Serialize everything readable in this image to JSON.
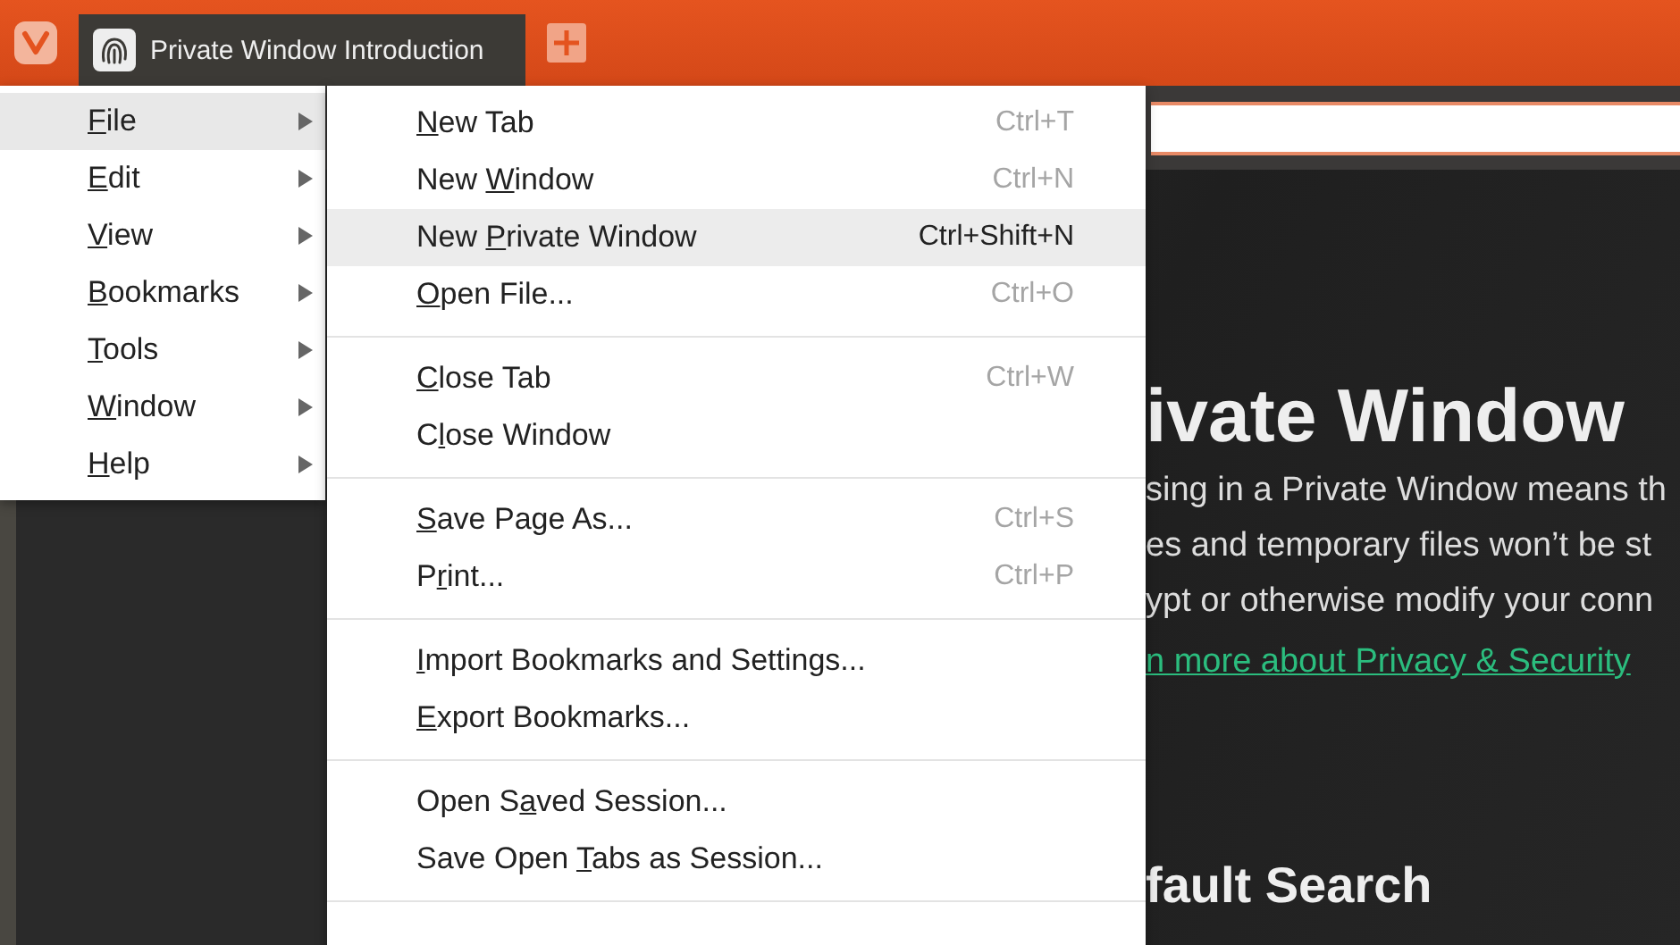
{
  "tab_bar": {
    "tabs": [
      {
        "title": "Private Window Introduction",
        "selected": true
      }
    ]
  },
  "main_menu": {
    "items": [
      {
        "key": "F",
        "post": "ile",
        "has_submenu": true,
        "selected": true
      },
      {
        "key": "E",
        "post": "dit",
        "has_submenu": true,
        "selected": false
      },
      {
        "key": "V",
        "post": "iew",
        "has_submenu": true,
        "selected": false
      },
      {
        "key": "B",
        "post": "ookmarks",
        "has_submenu": true,
        "selected": false
      },
      {
        "key": "T",
        "post": "ools",
        "has_submenu": true,
        "selected": false
      },
      {
        "key": "W",
        "post": "indow",
        "has_submenu": true,
        "selected": false
      },
      {
        "key": "H",
        "post": "elp",
        "has_submenu": true,
        "selected": false
      }
    ]
  },
  "file_menu": {
    "groups": [
      [
        {
          "key": "N",
          "post": "ew Tab",
          "shortcut": "Ctrl+T",
          "selected": false
        },
        {
          "pre": "New ",
          "key": "W",
          "post": "indow",
          "shortcut": "Ctrl+N",
          "selected": false
        },
        {
          "pre": "New ",
          "key": "P",
          "post": "rivate Window",
          "shortcut": "Ctrl+Shift+N",
          "selected": true
        },
        {
          "key": "O",
          "post": "pen File...",
          "shortcut": "Ctrl+O",
          "selected": false
        }
      ],
      [
        {
          "key": "C",
          "post": "lose Tab",
          "shortcut": "Ctrl+W",
          "selected": false
        },
        {
          "pre": "C",
          "key": "l",
          "post": "ose Window",
          "selected": false
        }
      ],
      [
        {
          "key": "S",
          "post": "ave Page As...",
          "shortcut": "Ctrl+S",
          "selected": false
        },
        {
          "pre": "P",
          "key": "r",
          "post": "int...",
          "shortcut": "Ctrl+P",
          "selected": false
        }
      ],
      [
        {
          "key": "I",
          "post": "mport Bookmarks and Settings...",
          "selected": false
        },
        {
          "key": "E",
          "post": "xport Bookmarks...",
          "selected": false
        }
      ],
      [
        {
          "pre": "Open S",
          "key": "a",
          "post": "ved Session...",
          "selected": false
        },
        {
          "pre": "Save Open ",
          "key": "T",
          "post": "abs as Session...",
          "selected": false
        }
      ]
    ]
  },
  "page": {
    "heading": "ivate Window",
    "paragraph_lines": [
      "sing in a Private Window means th",
      "es and temporary files won’t be st",
      "ypt or otherwise modify your conn"
    ],
    "link": "n more about Privacy & Security",
    "subheading": "fault Search"
  }
}
